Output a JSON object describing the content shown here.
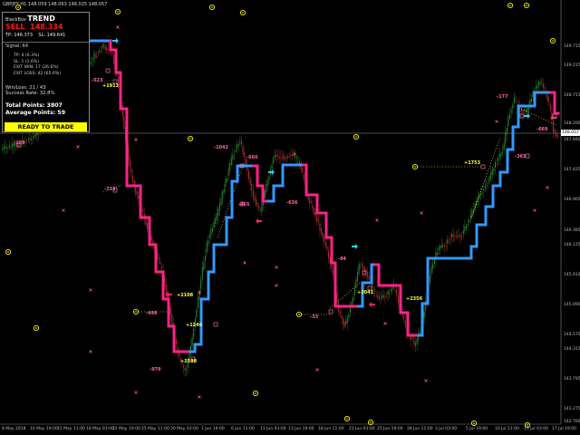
{
  "symbol_line": "GBPJPY,H1  148.059 148.063 148.025 148.057",
  "panel": {
    "brand": "BlackBox",
    "product": "TREND",
    "signal": "SELL",
    "signal_price": "148.334",
    "tp": "TP: 146.373",
    "sl": "SL: 149.641",
    "signal_count": "Signal: 64",
    "stats": [
      "TP: 4 (6.3%)",
      "SL: 1 (1.6%)",
      "EXIT WIN: 17 (26.6%)",
      "EXIT LOSS: 42 (65.6%)"
    ],
    "winloss": "Win/Loss: 21 / 43",
    "success_rate": "Success Rate: 32.8%",
    "total_points": "Total Points: 3807",
    "average_points": "Average Points: 59",
    "ready_button": "READY TO TRADE"
  },
  "current_price": "148.057",
  "price_axis": [
    "149.715",
    "149.215",
    "148.715",
    "148.200",
    "147.940",
    "147.425",
    "146.905",
    "146.385",
    "146.125",
    "145.610",
    "145.090",
    "144.570",
    "144.315",
    "143.795",
    "143.275",
    "142.760"
  ],
  "time_axis": [
    "8 May 2018",
    "10 May 19:00",
    "15 May 11:00",
    "18 May 03:00",
    "22 May 19:00",
    "25 May 11:00",
    "30 May 03:00",
    "1 Jun 19:00",
    "6 Jun 11:00",
    "11 Jun 03:00",
    "13 Jun 19:00",
    "18 Jun 11:00",
    "21 Jun 03:00",
    "25 Jun 19:00",
    "28 Jun 11:00",
    "3 Jul 03:00",
    "5 Jul 19:00",
    "10 Jul 11:00",
    "13 Jul 03:00",
    "17 Jul 19:00"
  ],
  "trade_labels": [
    {
      "text": "-109",
      "type": "neg"
    },
    {
      "text": "-523",
      "type": "neg"
    },
    {
      "text": "+1913",
      "type": "pos"
    },
    {
      "text": "-733",
      "type": "neg"
    },
    {
      "text": "+2108",
      "type": "pos"
    },
    {
      "text": "-498",
      "type": "neg"
    },
    {
      "text": "+1246",
      "type": "pos"
    },
    {
      "text": "-979",
      "type": "neg"
    },
    {
      "text": "+2588",
      "type": "pos"
    },
    {
      "text": "-1042",
      "type": "neg"
    },
    {
      "text": "-660",
      "type": "neg"
    },
    {
      "text": "-465",
      "type": "neg"
    },
    {
      "text": "-636",
      "type": "neg"
    },
    {
      "text": "-84",
      "type": "neg"
    },
    {
      "text": "+2041",
      "type": "pos"
    },
    {
      "text": "-33",
      "type": "neg"
    },
    {
      "text": "+2356",
      "type": "pos"
    },
    {
      "text": "+1753",
      "type": "pos"
    },
    {
      "text": "-177",
      "type": "neg"
    },
    {
      "text": "-669",
      "type": "neg"
    },
    {
      "text": "-365",
      "type": "neg"
    }
  ],
  "colors": {
    "up_trend": "#3399ff",
    "down_trend": "#ff2288",
    "bull_candle": "#2e8b2e",
    "bear_candle": "#b03030",
    "target": "#ffff00",
    "background": "#000000"
  }
}
